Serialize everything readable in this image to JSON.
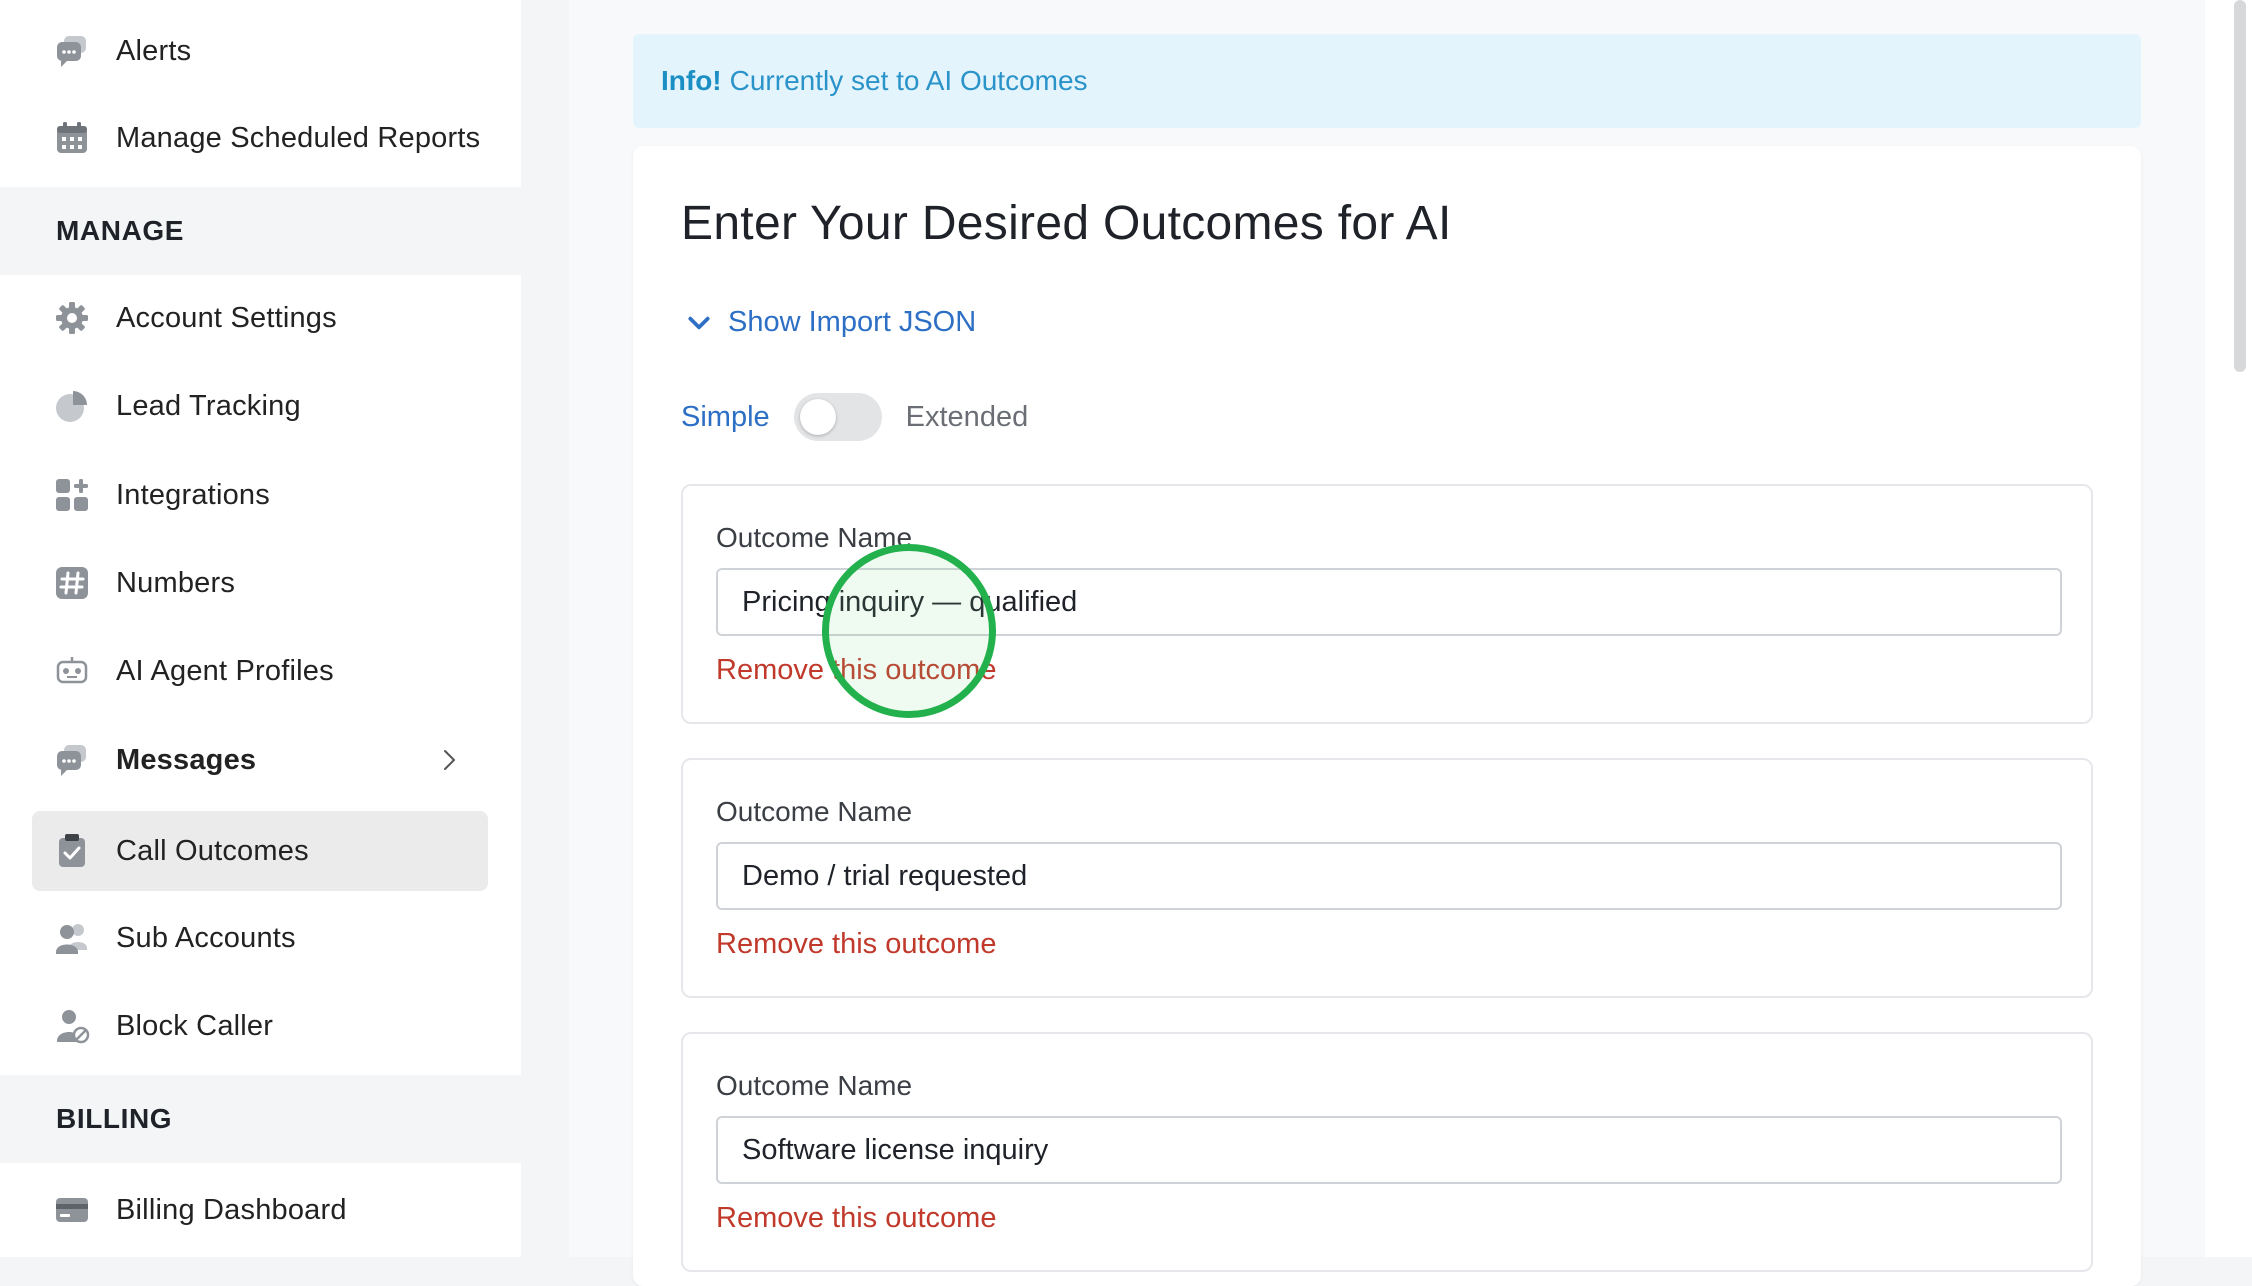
{
  "sidebar": {
    "items_top": [
      {
        "label": "Alerts",
        "icon": "chat-bubble-icon"
      },
      {
        "label": "Manage Scheduled Reports",
        "icon": "calendar-icon"
      }
    ],
    "section_manage": "MANAGE",
    "items_manage": [
      {
        "label": "Account Settings",
        "icon": "gear-icon"
      },
      {
        "label": "Lead Tracking",
        "icon": "pie-chart-icon"
      },
      {
        "label": "Integrations",
        "icon": "grid-plus-icon"
      },
      {
        "label": "Numbers",
        "icon": "hash-icon"
      },
      {
        "label": "AI Agent Profiles",
        "icon": "robot-icon"
      },
      {
        "label": "Messages",
        "icon": "chat-bubble-icon"
      },
      {
        "label": "Call Outcomes",
        "icon": "clipboard-check-icon"
      },
      {
        "label": "Sub Accounts",
        "icon": "users-icon"
      },
      {
        "label": "Block Caller",
        "icon": "user-block-icon"
      }
    ],
    "section_billing": "BILLING",
    "items_billing": [
      {
        "label": "Billing Dashboard",
        "icon": "credit-card-icon"
      }
    ],
    "active_item": "Call Outcomes"
  },
  "alert": {
    "strong": "Info!",
    "message": "Currently set to AI Outcomes"
  },
  "card": {
    "title": "Enter Your Desired Outcomes for AI",
    "import_toggle": "Show Import JSON",
    "mode_simple": "Simple",
    "mode_extended": "Extended",
    "mode_extended_on": false
  },
  "outcomes": [
    {
      "label": "Outcome Name",
      "value": "Pricing inquiry — qualified",
      "remove": "Remove this outcome"
    },
    {
      "label": "Outcome Name",
      "value": "Demo / trial requested",
      "remove": "Remove this outcome"
    },
    {
      "label": "Outcome Name",
      "value": "Software license inquiry",
      "remove": "Remove this outcome"
    }
  ],
  "colors": {
    "accent_blue": "#2c6fc4",
    "danger_red": "#c0392b",
    "click_indicator": "#22b14c"
  }
}
